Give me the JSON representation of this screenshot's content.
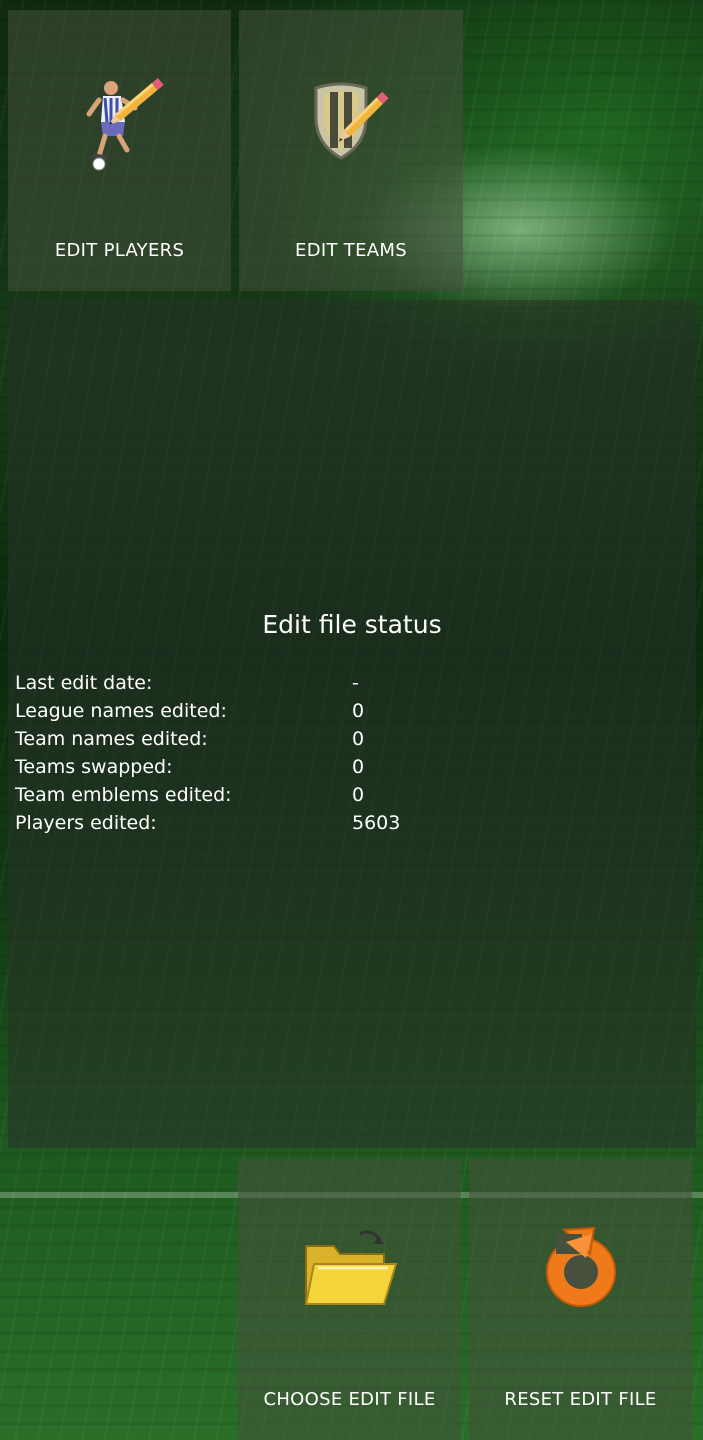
{
  "tiles": {
    "edit_players": {
      "label": "EDIT PLAYERS",
      "icon": "player-pencil-icon"
    },
    "edit_teams": {
      "label": "EDIT TEAMS",
      "icon": "shield-pencil-icon"
    },
    "choose_edit_file": {
      "label": "CHOOSE EDIT FILE",
      "icon": "folder-open-icon"
    },
    "reset_edit_file": {
      "label": "RESET EDIT FILE",
      "icon": "reset-arrow-icon"
    }
  },
  "status": {
    "title": "Edit file status",
    "rows": [
      {
        "label": "Last edit date:",
        "value": "-"
      },
      {
        "label": "League names edited:",
        "value": "0"
      },
      {
        "label": "Team names edited:",
        "value": "0"
      },
      {
        "label": "Teams swapped:",
        "value": "0"
      },
      {
        "label": "Team emblems edited:",
        "value": "0"
      },
      {
        "label": "Players edited:",
        "value": "5603"
      }
    ]
  },
  "colors": {
    "tile_bg": "#46503c",
    "accent_orange": "#f07a1a",
    "folder_yellow": "#f5d33a",
    "background_green": "#163a17"
  }
}
